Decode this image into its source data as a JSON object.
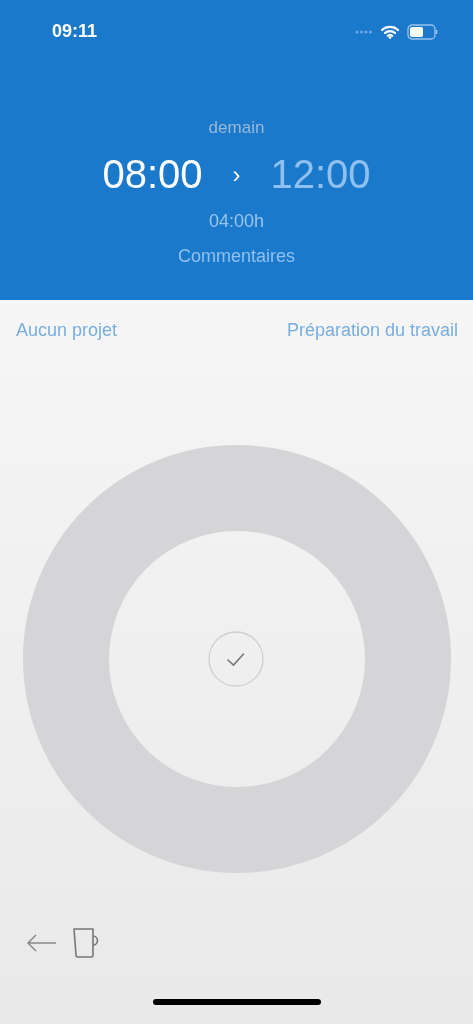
{
  "status_bar": {
    "time": "09:11"
  },
  "header": {
    "day": "demain",
    "start": "08:00",
    "separator": "›",
    "end": "12:00",
    "duration": "04:00h",
    "comments": "Commentaires"
  },
  "assignment": {
    "project": "Aucun projet",
    "task": "Préparation du travail"
  }
}
